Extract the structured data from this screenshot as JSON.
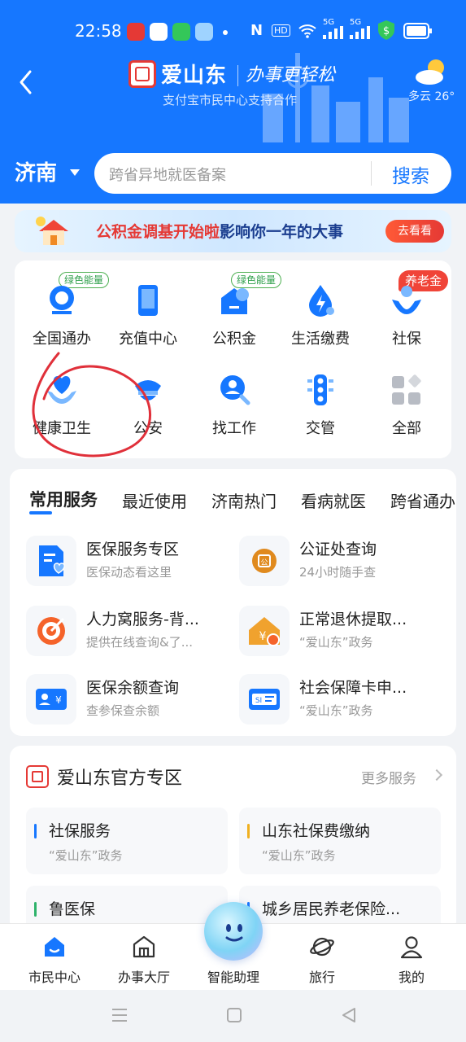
{
  "status_bar": {
    "time": "22:58",
    "nfc": "N",
    "hd": "HD",
    "net1": "5G",
    "net2": "5G"
  },
  "header": {
    "brand": "爱山东",
    "slogan": "办事更轻松",
    "subtitle": "支付宝市民中心支持合作",
    "weather": "多云 26°",
    "city": "济南",
    "search_placeholder": "跨省异地就医备案",
    "search_button": "搜索"
  },
  "banner": {
    "text_red": "公积金调基开始啦",
    "text_dark": "影响你一年的大事",
    "button": "去看看"
  },
  "grid": {
    "items": [
      {
        "label": "全国通办",
        "tag": "绿色能量"
      },
      {
        "label": "充值中心"
      },
      {
        "label": "公积金",
        "tag": "绿色能量"
      },
      {
        "label": "生活缴费"
      },
      {
        "label": "社保",
        "tag": "养老金"
      },
      {
        "label": "健康卫生"
      },
      {
        "label": "公安"
      },
      {
        "label": "找工作"
      },
      {
        "label": "交管"
      },
      {
        "label": "全部"
      }
    ]
  },
  "services": {
    "tabs": [
      "常用服务",
      "最近使用",
      "济南热门",
      "看病就医",
      "跨省通办"
    ],
    "items": [
      {
        "title": "医保服务专区",
        "sub": "医保动态看这里"
      },
      {
        "title": "公证处查询",
        "sub": "24小时随手查"
      },
      {
        "title": "人力窝服务-背...",
        "sub": "提供在线查询&了..."
      },
      {
        "title": "正常退休提取...",
        "sub": "“爱山东”政务"
      },
      {
        "title": "医保余额查询",
        "sub": "查参保查余额"
      },
      {
        "title": "社会保障卡申...",
        "sub": "“爱山东”政务"
      }
    ]
  },
  "official": {
    "title": "爱山东官方专区",
    "more": "更多服务",
    "items": [
      {
        "title": "社保服务",
        "sub": "“爱山东”政务"
      },
      {
        "title": "山东社保费缴纳",
        "sub": "“爱山东”政务"
      },
      {
        "title": "鲁医保",
        "sub": ""
      },
      {
        "title": "城乡居民养老保险...",
        "sub": ""
      }
    ]
  },
  "tabbar": {
    "items": [
      "市民中心",
      "办事大厅",
      "智能助理",
      "旅行",
      "我的"
    ]
  },
  "colors": {
    "primary": "#1677ff",
    "accent_red": "#e53935",
    "tag_green": "#2e9f4a"
  }
}
